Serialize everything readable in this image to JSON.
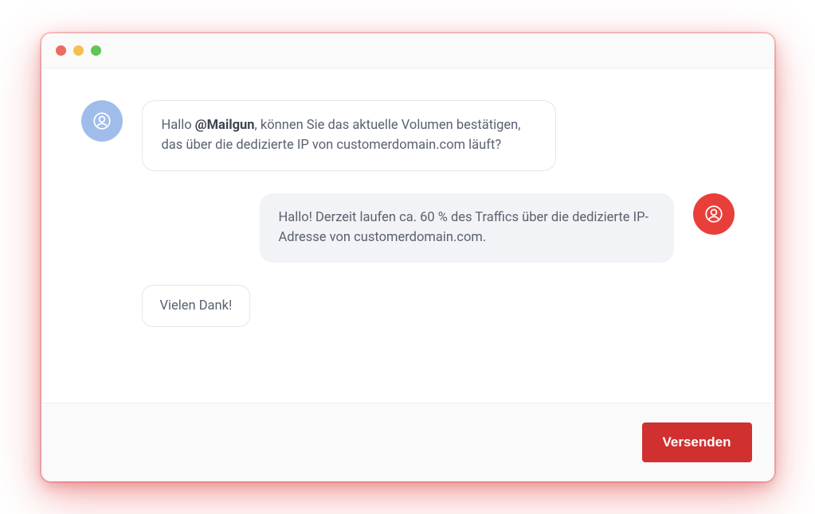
{
  "colors": {
    "accent_red": "#d13030",
    "avatar_user": "#a0bdea",
    "avatar_agent": "#e93f3b"
  },
  "messages": {
    "m1_pre": "Hallo ",
    "m1_mention": "@Mailgun",
    "m1_post": ", können Sie das aktuelle Volumen bestätigen, das über die dedizierte IP von customerdomain.com läuft?",
    "m2": "Hallo! Derzeit laufen ca. 60 % des Traffics über die dedizierte IP-Adresse von customerdomain.com.",
    "m3": "Vielen Dank!"
  },
  "footer": {
    "send_label": "Versenden"
  }
}
